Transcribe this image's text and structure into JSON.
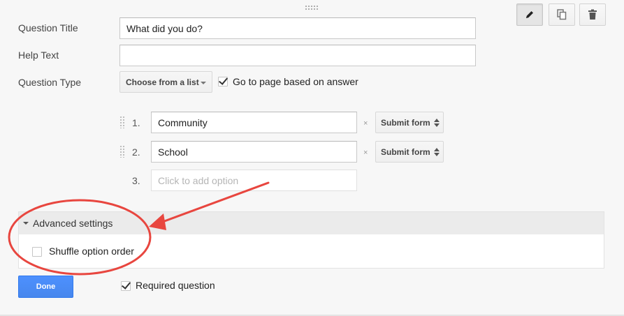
{
  "toolbar": {
    "edit_icon": "pencil-icon",
    "duplicate_icon": "duplicate-icon",
    "delete_icon": "trash-icon"
  },
  "form": {
    "question_title_label": "Question Title",
    "question_title_value": "What did you do?",
    "help_text_label": "Help Text",
    "help_text_value": "",
    "question_type_label": "Question Type",
    "question_type_value": "Choose from a list",
    "go_to_page_label": "Go to page based on answer",
    "go_to_page_checked": true
  },
  "options": [
    {
      "number": "1.",
      "value": "Community",
      "remove": "×",
      "action": "Submit form"
    },
    {
      "number": "2.",
      "value": "School",
      "remove": "×",
      "action": "Submit form"
    }
  ],
  "new_option": {
    "number": "3.",
    "placeholder": "Click to add option"
  },
  "advanced": {
    "header": "Advanced settings",
    "shuffle_label": "Shuffle option order",
    "shuffle_checked": false
  },
  "footer": {
    "done_label": "Done",
    "required_label": "Required question",
    "required_checked": true
  },
  "colors": {
    "done_button": "#4d90fe",
    "callout": "#e8463f"
  }
}
